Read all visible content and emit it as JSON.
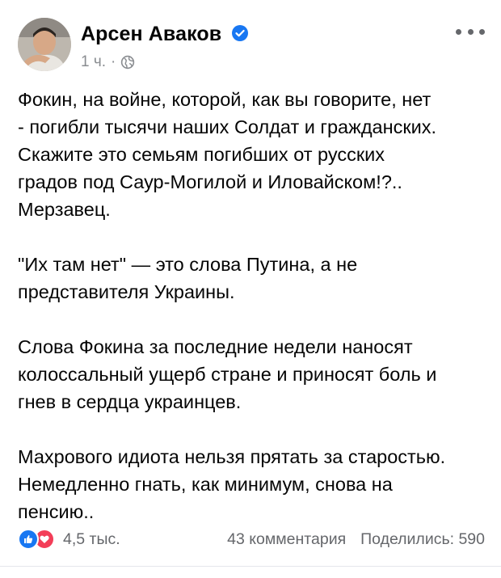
{
  "post": {
    "author": "Арсен Аваков",
    "time": "1 ч.",
    "separator": "·",
    "icons": {
      "verified": "verified-badge-icon",
      "privacy": "globe-icon",
      "menu": "more-options-icon"
    },
    "paragraphs": [
      "Фокин, на войне, которой, как вы говорите, нет\n- погибли тысячи наших Солдат и гражданских.\nСкажите это семьям погибших от русских\nградов под Саур-Могилой и Иловайском!?..\nМерзавец.",
      "\"Их там нет\" — это слова Путина, а не\nпредставителя Украины.",
      "Слова Фокина за последние недели наносят\nколоссальный ущерб  стране и приносят боль и\nгнев в сердца украинцев.",
      "Махрового идиота нельзя прятать за старостью.\nНемедленно гнать, как минимум, снова на\nпенсию.."
    ],
    "reactions_count": "4,5 тыс.",
    "comments": "43 комментария",
    "shares": "Поделились: 590"
  },
  "colors": {
    "accent": "#1877f2",
    "love": "#f33e58",
    "secondary_text": "#65676b"
  }
}
